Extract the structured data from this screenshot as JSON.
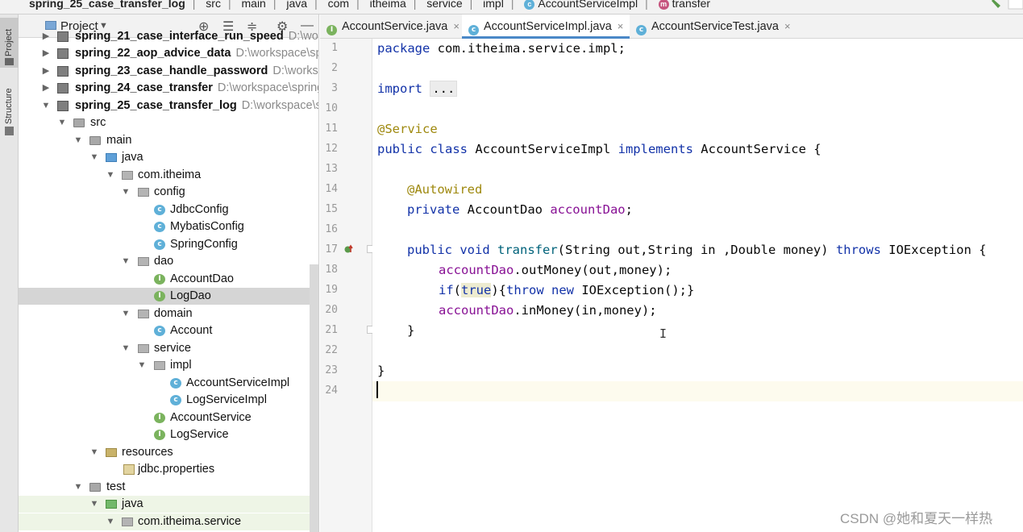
{
  "breadcrumb": {
    "items": [
      "spring_25_case_transfer_log",
      "src",
      "main",
      "java",
      "com",
      "itheima",
      "service",
      "impl",
      "AccountServiceImpl",
      "transfer"
    ]
  },
  "left_stripe": {
    "project_tab": "Project",
    "structure_tab": "Structure"
  },
  "project_panel": {
    "title": "Project",
    "header_icons": [
      "target-icon",
      "expand-all-icon",
      "collapse-all-icon",
      "gear-icon",
      "minimize-icon"
    ],
    "tree": [
      {
        "label": "spring_21_case_interface_run_speed",
        "path": "D:\\work",
        "icon": "module-icon",
        "bold": true
      },
      {
        "label": "spring_22_aop_advice_data",
        "path": "D:\\workspace\\sp",
        "icon": "module-icon",
        "bold": true
      },
      {
        "label": "spring_23_case_handle_password",
        "path": "D:\\worksp",
        "icon": "module-icon",
        "bold": true
      },
      {
        "label": "spring_24_case_transfer",
        "path": "D:\\workspace\\spring",
        "icon": "module-icon",
        "bold": true
      },
      {
        "label": "spring_25_case_transfer_log",
        "path": "D:\\workspace\\s",
        "icon": "module-icon",
        "bold": true
      },
      {
        "label": "src",
        "path": "",
        "icon": "folder-icon"
      },
      {
        "label": "main",
        "path": "",
        "icon": "folder-icon"
      },
      {
        "label": "java",
        "path": "",
        "icon": "source-folder-icon"
      },
      {
        "label": "com.itheima",
        "path": "",
        "icon": "package-icon"
      },
      {
        "label": "config",
        "path": "",
        "icon": "package-icon"
      },
      {
        "label": "JdbcConfig",
        "path": "",
        "icon": "class-icon"
      },
      {
        "label": "MybatisConfig",
        "path": "",
        "icon": "class-icon"
      },
      {
        "label": "SpringConfig",
        "path": "",
        "icon": "class-icon"
      },
      {
        "label": "dao",
        "path": "",
        "icon": "package-icon"
      },
      {
        "label": "AccountDao",
        "path": "",
        "icon": "interface-icon"
      },
      {
        "label": "LogDao",
        "path": "",
        "icon": "interface-icon"
      },
      {
        "label": "domain",
        "path": "",
        "icon": "package-icon"
      },
      {
        "label": "Account",
        "path": "",
        "icon": "class-icon"
      },
      {
        "label": "service",
        "path": "",
        "icon": "package-icon"
      },
      {
        "label": "impl",
        "path": "",
        "icon": "package-icon"
      },
      {
        "label": "AccountServiceImpl",
        "path": "",
        "icon": "class-icon"
      },
      {
        "label": "LogServiceImpl",
        "path": "",
        "icon": "class-icon"
      },
      {
        "label": "AccountService",
        "path": "",
        "icon": "interface-icon"
      },
      {
        "label": "LogService",
        "path": "",
        "icon": "interface-icon"
      },
      {
        "label": "resources",
        "path": "",
        "icon": "resources-folder-icon"
      },
      {
        "label": "jdbc.properties",
        "path": "",
        "icon": "properties-file-icon"
      },
      {
        "label": "test",
        "path": "",
        "icon": "folder-icon"
      },
      {
        "label": "java",
        "path": "",
        "icon": "test-folder-icon"
      },
      {
        "label": "com.itheima.service",
        "path": "",
        "icon": "package-icon"
      }
    ]
  },
  "editor_tabs": [
    {
      "label": "AccountService.java",
      "icon": "interface-icon",
      "active": false
    },
    {
      "label": "AccountServiceImpl.java",
      "icon": "class-icon",
      "active": true
    },
    {
      "label": "AccountServiceTest.java",
      "icon": "test-class-icon",
      "active": false
    }
  ],
  "code": {
    "line_numbers": [
      "1",
      "2",
      "3",
      "10",
      "11",
      "12",
      "13",
      "14",
      "15",
      "16",
      "17",
      "18",
      "19",
      "20",
      "21",
      "22",
      "23",
      "24"
    ],
    "lines": {
      "l1_kw": "package",
      "l1_rest": " com.itheima.service.impl;",
      "l3_kw": "import",
      "l3_fold": "...",
      "l11_an": "@Service",
      "l12_kw1": "public class",
      "l12_name": " AccountServiceImpl ",
      "l12_kw2": "implements",
      "l12_rest": " AccountService {",
      "l14_an": "@Autowired",
      "l15_kw": "private",
      "l15_type": " AccountDao ",
      "l15_field": "accountDao",
      "l15_end": ";",
      "l17_kw": "public void",
      "l17_sp": " ",
      "l17_method": "transfer",
      "l17_params": "(String out,String in ,Double money) ",
      "l17_throws": "throws",
      "l17_rest": " IOException {",
      "l18_field": "accountDao",
      "l18_rest": ".outMoney(out,money);",
      "l19_kw1": "if",
      "l19_p1": "(",
      "l19_true": "true",
      "l19_p2": "){",
      "l19_kw2": "throw new",
      "l19_rest": " IOException();}",
      "l20_field": "accountDao",
      "l20_rest": ".inMoney(in,money);",
      "l21": "}",
      "l23": "}"
    }
  },
  "watermark": "CSDN @她和夏天一样热",
  "colors": {
    "keyword": "#1232a8",
    "annotation": "#9e880d",
    "field": "#871094",
    "method": "#00627a",
    "selection": "#d5d5d5",
    "active_tab_underline": "#4a88c7"
  }
}
